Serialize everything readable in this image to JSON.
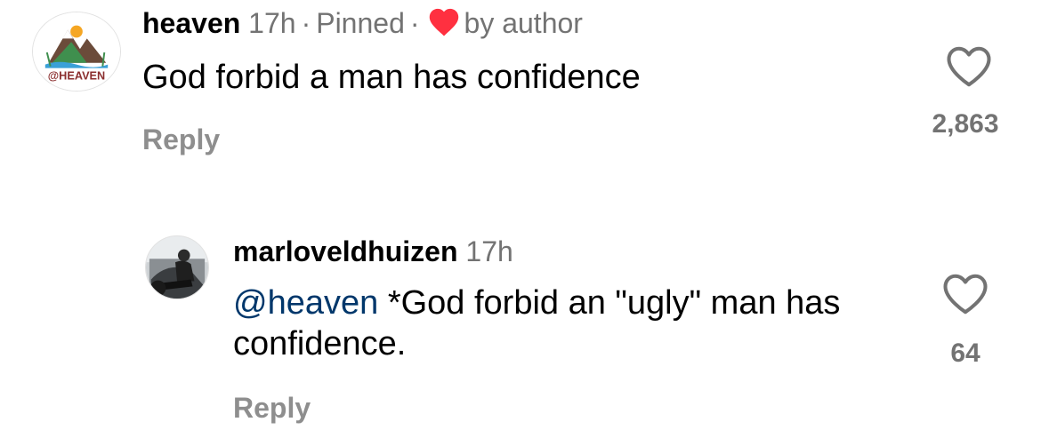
{
  "comments": [
    {
      "username": "heaven",
      "time": "17h",
      "pinned_label": "Pinned",
      "separator": "·",
      "liked_by_label": "by author",
      "avatar_icon": "heaven-brand-logo",
      "avatar_text": "@HEAVEN",
      "text": "God forbid a man has confidence",
      "reply_label": "Reply",
      "like_count": "2,863"
    },
    {
      "username": "marloveldhuizen",
      "time": "17h",
      "avatar_icon": "user-photo",
      "mention": "@heaven",
      "text": "*God forbid an \"ugly\" man has confidence.",
      "reply_label": "Reply",
      "like_count": "64"
    }
  ],
  "colors": {
    "author_heart": "#ff3040",
    "mention": "#00376b",
    "meta_text": "#737373",
    "reply_text": "#8e8e8e"
  }
}
